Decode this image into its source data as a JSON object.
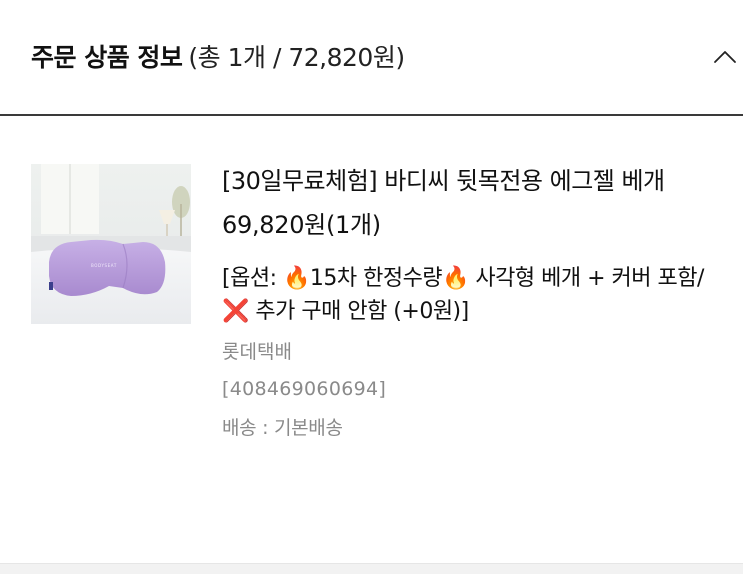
{
  "header": {
    "title": "주문 상품 정보",
    "summary": "(총 1개 / 72,820원)",
    "toggle_icon": "chevron-up-icon"
  },
  "product": {
    "image_icon": "lavender-pillow-photo",
    "name": "[30일무료체험] 바디씨 뒷목전용 에그젤 베개",
    "price": "69,820원(1개)",
    "option": "[옵션: 🔥15차 한정수량🔥 사각형 베개 + 커버 포함/❌ 추가 구매 안함 (+0원)]",
    "courier": "롯데택배",
    "tracking_number": "[408469060694]",
    "shipping": "배송 : 기본배송"
  },
  "colors": {
    "header_border": "#3a3a3a",
    "muted_text": "#8a8a8a",
    "pillow": "#b49ad8",
    "background": "#ffffff"
  }
}
